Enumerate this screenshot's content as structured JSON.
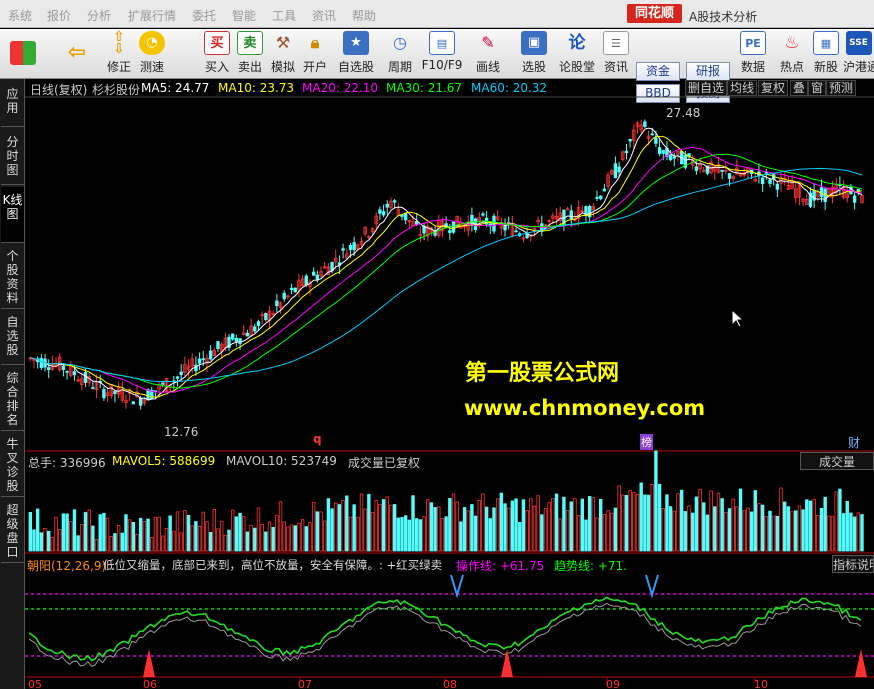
{
  "menu": [
    "系统",
    "报价",
    "分析",
    "扩展行情",
    "委托",
    "智能",
    "工具",
    "资讯",
    "帮助"
  ],
  "brand": "同花顺",
  "app_title": "A股技术分析",
  "toolbar": {
    "buttons": [
      {
        "label": "",
        "icon": "windows-icon"
      },
      {
        "label": "",
        "icon": "back-arrow-icon"
      },
      {
        "label": "修正",
        "icon": "up-down-arrows-icon"
      },
      {
        "label": "测速",
        "icon": "clock-icon"
      },
      {
        "label": "买入",
        "icon": "buy-icon",
        "glyph": "买"
      },
      {
        "label": "卖出",
        "icon": "sell-icon",
        "glyph": "卖"
      },
      {
        "label": "模拟",
        "icon": "gavel-icon"
      },
      {
        "label": "开户",
        "icon": "lock-icon"
      },
      {
        "label": "自选股",
        "icon": "star-icon"
      },
      {
        "label": "周期",
        "icon": "cycle-icon"
      },
      {
        "label": "F10/F9",
        "icon": "f10-icon"
      },
      {
        "label": "画线",
        "icon": "pen-icon"
      },
      {
        "label": "选股",
        "icon": "stock-pick-icon"
      },
      {
        "label": "论股堂",
        "icon": "forum-icon",
        "glyph": "论"
      },
      {
        "label": "资讯",
        "icon": "news-icon"
      },
      {
        "label": "数据",
        "icon": "pe-icon",
        "glyph": "PE"
      },
      {
        "label": "热点",
        "icon": "hot-icon"
      },
      {
        "label": "新股",
        "icon": "new-stock-icon"
      },
      {
        "label": "沪港通",
        "icon": "hk-connect-icon"
      }
    ],
    "boxes": [
      "资金",
      "研报",
      "BBD",
      "预测"
    ]
  },
  "left_tabs": [
    "应用",
    "分时图",
    "K线图",
    "个股资料",
    "自选股",
    "综合排名",
    "牛叉诊股",
    "超级盘口"
  ],
  "price_header": {
    "period": "日线(复权)",
    "stock": "杉杉股份",
    "ma": [
      {
        "label": "MA5: 24.77",
        "color": "#ffffff"
      },
      {
        "label": "MA10: 23.73",
        "color": "#ffff00"
      },
      {
        "label": "MA20: 22.10",
        "color": "#ff00ff"
      },
      {
        "label": "MA30: 21.67",
        "color": "#00ff00"
      },
      {
        "label": "MA60: 20.32",
        "color": "#00ccff"
      }
    ],
    "buttons": [
      "删自选",
      "均线",
      "复权",
      "叠",
      "窗",
      "预测"
    ]
  },
  "annotations": {
    "high": "27.48",
    "low": "12.76",
    "marker_q": "q",
    "marker_bang": "榜",
    "marker_cai": "财"
  },
  "volume_header": {
    "total": "总手: 336996",
    "mavol5": "MAVOL5: 588699",
    "mavol10": "MAVOL10: 523749",
    "note": "成交量已复权",
    "button": "成交量"
  },
  "indicator_header": {
    "name": "朝阳(12,26,9)",
    "desc": "低位又缩量，底部已来到，高位不放量，安全有保障。: +红买绿卖",
    "op_line": "操作线: +61.75",
    "trend_line": "趋势线: +71.",
    "button": "指标说明"
  },
  "x_axis": [
    "05",
    "06",
    "07",
    "08",
    "09",
    "10"
  ],
  "watermark": {
    "line1": "第一股票公式网",
    "line2": "www.chnmoney.com"
  },
  "colors": {
    "up": "#ff3232",
    "down": "#54fcfc",
    "ma5": "#ffffff",
    "ma10": "#ffff00",
    "ma20": "#ff00ff",
    "ma30": "#00ff00",
    "ma60": "#00ccff"
  }
}
